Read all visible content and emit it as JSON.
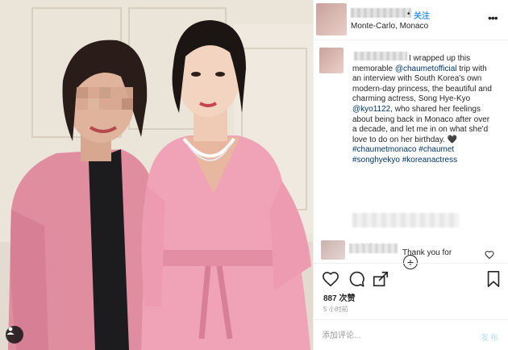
{
  "post": {
    "header": {
      "follow_dot": "•",
      "follow_label": "关注",
      "location": "Monte-Carlo, Monaco",
      "more_icon": "more-options-icon"
    },
    "caption": {
      "text_part1": "I wrapped up this memorable ",
      "mention1": "@chaumetofficial",
      "text_part2": " trip with an interview with South Korea's own modern-day princess, the beautiful and charming actress, Song Hye-Kyo ",
      "mention2": "@kyo1122",
      "text_part3": ", who shared her feelings about being back in Monaco after over a decade, and let me in on what she'd love to do on her birthday. 🖤 ",
      "hashtag1": "#chaumetmonaco",
      "hashtag2": "#chaumet",
      "hashtag3": "#songhyekyo",
      "hashtag4": "#koreanactress",
      "time": "5 小时"
    },
    "load_more_icon": "plus-circle-icon",
    "comment": {
      "text": "Thank you for"
    },
    "actions": {
      "like_icon": "heart-icon",
      "comment_icon": "comment-icon",
      "share_icon": "share-icon",
      "save_icon": "bookmark-icon"
    },
    "likes": "887 次赞",
    "posted_time": "5 小时前",
    "add_comment": {
      "placeholder": "添加评论...",
      "post_label": "发布"
    },
    "colors": {
      "link": "#003569",
      "follow": "#3897f0",
      "post_disabled": "#b2dffc",
      "muted": "#999999"
    }
  }
}
